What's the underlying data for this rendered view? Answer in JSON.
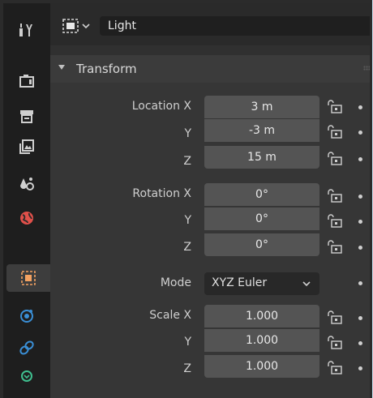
{
  "header": {
    "object_name": "Light",
    "object_type_icon": "object-data-icon"
  },
  "sidebar": {
    "tabs": [
      {
        "name": "tool",
        "icon": "tool-icon"
      },
      {
        "name": "render",
        "icon": "render-icon"
      },
      {
        "name": "output",
        "icon": "output-icon"
      },
      {
        "name": "view-layer",
        "icon": "view-layer-icon"
      },
      {
        "name": "scene",
        "icon": "scene-icon"
      },
      {
        "name": "world",
        "icon": "world-icon"
      },
      {
        "name": "object",
        "icon": "object-icon",
        "active": true
      },
      {
        "name": "physics",
        "icon": "physics-icon"
      },
      {
        "name": "object-constraints",
        "icon": "constraints-icon"
      },
      {
        "name": "object-data",
        "icon": "light-data-icon"
      }
    ]
  },
  "panel": {
    "title": "Transform",
    "location": {
      "label_x": "Location X",
      "label_y": "Y",
      "label_z": "Z",
      "x": "3 m",
      "y": "-3 m",
      "z": "15 m"
    },
    "rotation": {
      "label_x": "Rotation X",
      "label_y": "Y",
      "label_z": "Z",
      "x": "0°",
      "y": "0°",
      "z": "0°"
    },
    "mode": {
      "label": "Mode",
      "value": "XYZ Euler"
    },
    "scale": {
      "label_x": "Scale X",
      "label_y": "Y",
      "label_z": "Z",
      "x": "1.000",
      "y": "1.000",
      "z": "1.000"
    }
  },
  "colors": {
    "object_tab_accent": "#f4a261",
    "world_icon": "#e0504a",
    "physics_icon": "#3a8fd6",
    "data_icon": "#3fbf8f"
  }
}
